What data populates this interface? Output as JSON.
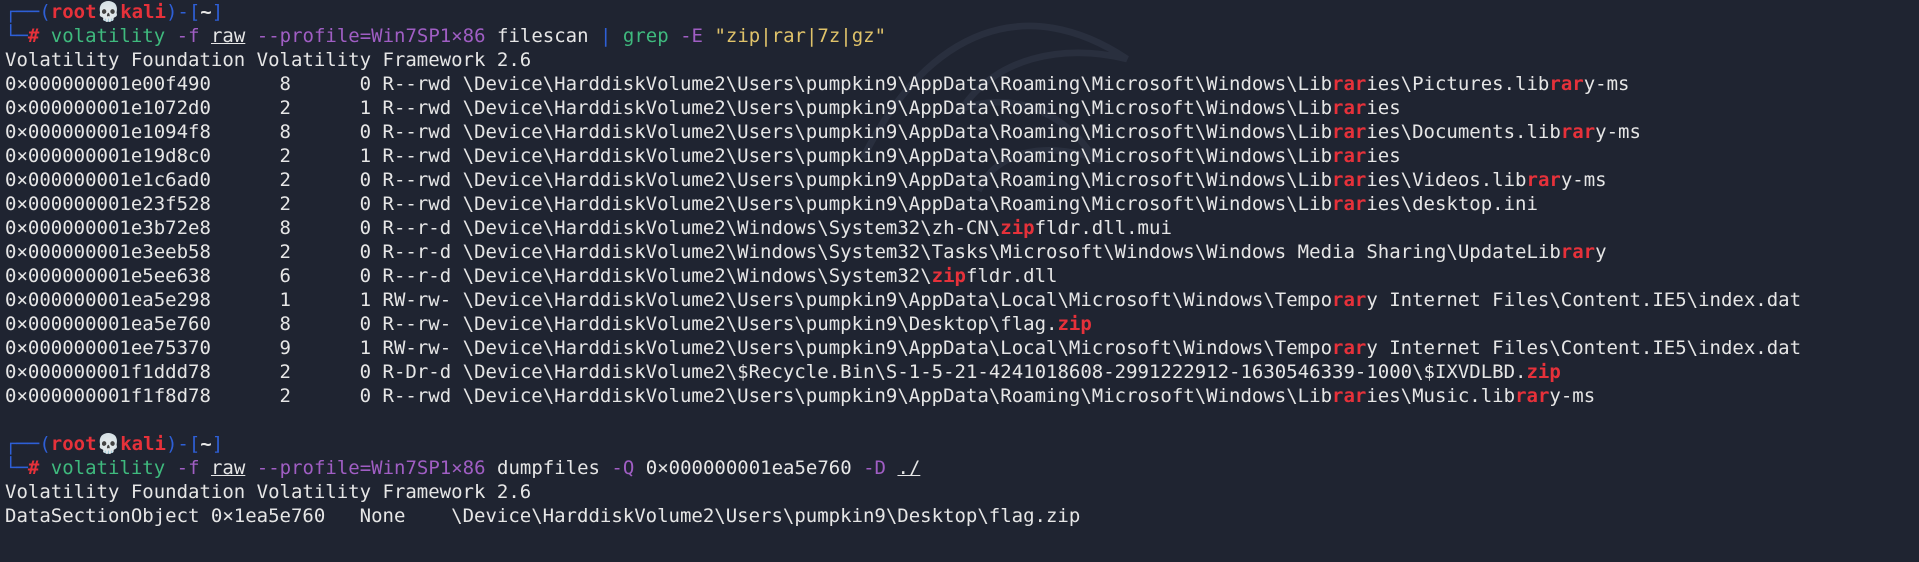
{
  "theme": {
    "background": "#1f2431",
    "prompt_bracket": "#2e5fd6",
    "prompt_user": "#e6313a",
    "command": "#3fba7e",
    "option": "#a05ec4",
    "string": "#e0c36a",
    "match_highlight": "#e6313a"
  },
  "prompt": {
    "top_left": "┌──(",
    "user": "root",
    "skull_icon": "skull-icon",
    "skull": "💀",
    "host": "kali",
    "mid": ")-[",
    "cwd": "~",
    "end": "]",
    "bottom_left": "└─",
    "hash": "#"
  },
  "commands": [
    {
      "tool": "volatility",
      "flag_f": "-f",
      "file": "raw",
      "profile": "--profile=Win7SP1×86",
      "plugin": "filescan",
      "pipe": "|",
      "grep": "grep",
      "grep_flag": "-E",
      "pattern": "\"zip|rar|7z|gz\""
    },
    {
      "tool": "volatility",
      "flag_f": "-f",
      "file": "raw",
      "profile": "--profile=Win7SP1×86",
      "plugin": "dumpfiles",
      "flag_q": "-Q",
      "offset": "0×000000001ea5e760",
      "flag_d": "-D",
      "dir": "./"
    }
  ],
  "banner": "Volatility Foundation Volatility Framework 2.6",
  "filescan_rows": [
    {
      "offset": "0×000000001e00f490",
      "ptr": "8",
      "hnd": "0",
      "access": "R--rwd",
      "path": [
        "\\Device\\HarddiskVolume2\\Users\\pumpkin9\\AppData\\Roaming\\Microsoft\\Windows\\Lib",
        "rar",
        "ies\\Pictures.lib",
        "rar",
        "y-ms"
      ]
    },
    {
      "offset": "0×000000001e1072d0",
      "ptr": "2",
      "hnd": "1",
      "access": "R--rwd",
      "path": [
        "\\Device\\HarddiskVolume2\\Users\\pumpkin9\\AppData\\Roaming\\Microsoft\\Windows\\Lib",
        "rar",
        "ies"
      ]
    },
    {
      "offset": "0×000000001e1094f8",
      "ptr": "8",
      "hnd": "0",
      "access": "R--rwd",
      "path": [
        "\\Device\\HarddiskVolume2\\Users\\pumpkin9\\AppData\\Roaming\\Microsoft\\Windows\\Lib",
        "rar",
        "ies\\Documents.lib",
        "rar",
        "y-ms"
      ]
    },
    {
      "offset": "0×000000001e19d8c0",
      "ptr": "2",
      "hnd": "1",
      "access": "R--rwd",
      "path": [
        "\\Device\\HarddiskVolume2\\Users\\pumpkin9\\AppData\\Roaming\\Microsoft\\Windows\\Lib",
        "rar",
        "ies"
      ]
    },
    {
      "offset": "0×000000001e1c6ad0",
      "ptr": "2",
      "hnd": "0",
      "access": "R--rwd",
      "path": [
        "\\Device\\HarddiskVolume2\\Users\\pumpkin9\\AppData\\Roaming\\Microsoft\\Windows\\Lib",
        "rar",
        "ies\\Videos.lib",
        "rar",
        "y-ms"
      ]
    },
    {
      "offset": "0×000000001e23f528",
      "ptr": "2",
      "hnd": "0",
      "access": "R--rwd",
      "path": [
        "\\Device\\HarddiskVolume2\\Users\\pumpkin9\\AppData\\Roaming\\Microsoft\\Windows\\Lib",
        "rar",
        "ies\\desktop.ini"
      ]
    },
    {
      "offset": "0×000000001e3b72e8",
      "ptr": "8",
      "hnd": "0",
      "access": "R--r-d",
      "path": [
        "\\Device\\HarddiskVolume2\\Windows\\System32\\zh-CN\\",
        "zip",
        "fldr.dll.mui"
      ]
    },
    {
      "offset": "0×000000001e3eeb58",
      "ptr": "2",
      "hnd": "0",
      "access": "R--r-d",
      "path": [
        "\\Device\\HarddiskVolume2\\Windows\\System32\\Tasks\\Microsoft\\Windows\\Windows Media Sharing\\UpdateLib",
        "rar",
        "y"
      ]
    },
    {
      "offset": "0×000000001e5ee638",
      "ptr": "6",
      "hnd": "0",
      "access": "R--r-d",
      "path": [
        "\\Device\\HarddiskVolume2\\Windows\\System32\\",
        "zip",
        "fldr.dll"
      ]
    },
    {
      "offset": "0×000000001ea5e298",
      "ptr": "1",
      "hnd": "1",
      "access": "RW-rw-",
      "path": [
        "\\Device\\HarddiskVolume2\\Users\\pumpkin9\\AppData\\Local\\Microsoft\\Windows\\Tempo",
        "rar",
        "y Internet Files\\Content.IE5\\index.dat"
      ]
    },
    {
      "offset": "0×000000001ea5e760",
      "ptr": "8",
      "hnd": "0",
      "access": "R--rw-",
      "path": [
        "\\Device\\HarddiskVolume2\\Users\\pumpkin9\\Desktop\\flag.",
        "zip"
      ]
    },
    {
      "offset": "0×000000001ee75370",
      "ptr": "9",
      "hnd": "1",
      "access": "RW-rw-",
      "path": [
        "\\Device\\HarddiskVolume2\\Users\\pumpkin9\\AppData\\Local\\Microsoft\\Windows\\Tempo",
        "rar",
        "y Internet Files\\Content.IE5\\index.dat"
      ]
    },
    {
      "offset": "0×000000001f1ddd78",
      "ptr": "2",
      "hnd": "0",
      "access": "R-Dr-d",
      "path": [
        "\\Device\\HarddiskVolume2\\$Recycle.Bin\\S-1-5-21-4241018608-2991222912-1630546339-1000\\$IXVDLBD.",
        "zip"
      ]
    },
    {
      "offset": "0×000000001f1f8d78",
      "ptr": "2",
      "hnd": "0",
      "access": "R--rwd",
      "path": [
        "\\Device\\HarddiskVolume2\\Users\\pumpkin9\\AppData\\Roaming\\Microsoft\\Windows\\Lib",
        "rar",
        "ies\\Music.lib",
        "rar",
        "y-ms"
      ]
    }
  ],
  "dump_result": {
    "type": "DataSectionObject",
    "offset": "0×1ea5e760",
    "name": "None",
    "path": "\\Device\\HarddiskVolume2\\Users\\pumpkin9\\Desktop\\flag.zip"
  }
}
